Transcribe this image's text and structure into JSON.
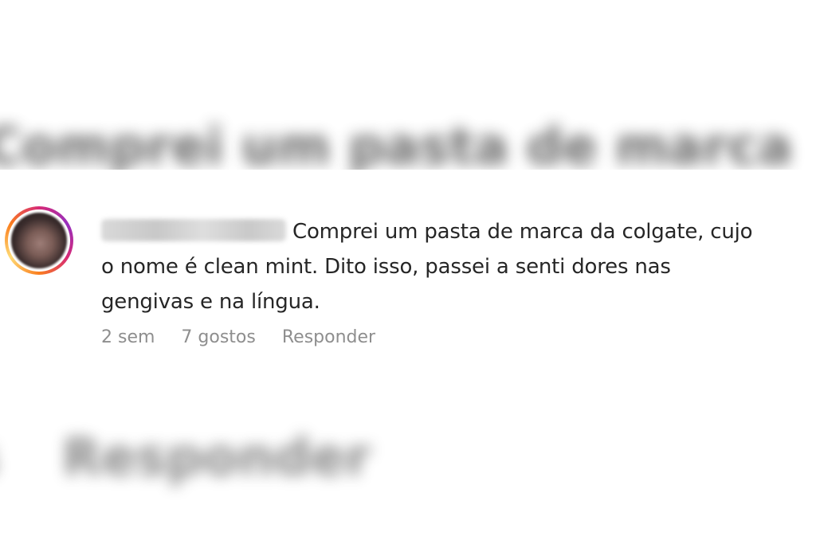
{
  "comment": {
    "text_line1": "Comprei um pasta de marca da colgate, cujo",
    "text_line2": "o nome é clean mint. Dito isso, passei a senti dores nas",
    "text_line3": "gengivas e na língua.",
    "time": "2 sem",
    "likes": "7 gostos",
    "reply_label": "Responder"
  },
  "icons": {
    "avatar": "user-avatar-story-ring"
  },
  "colors": {
    "text": "#262626",
    "meta": "#8e8e8e",
    "story_ring": [
      "#d62976",
      "#962fbf",
      "#fa7e1e",
      "#feda75"
    ]
  }
}
